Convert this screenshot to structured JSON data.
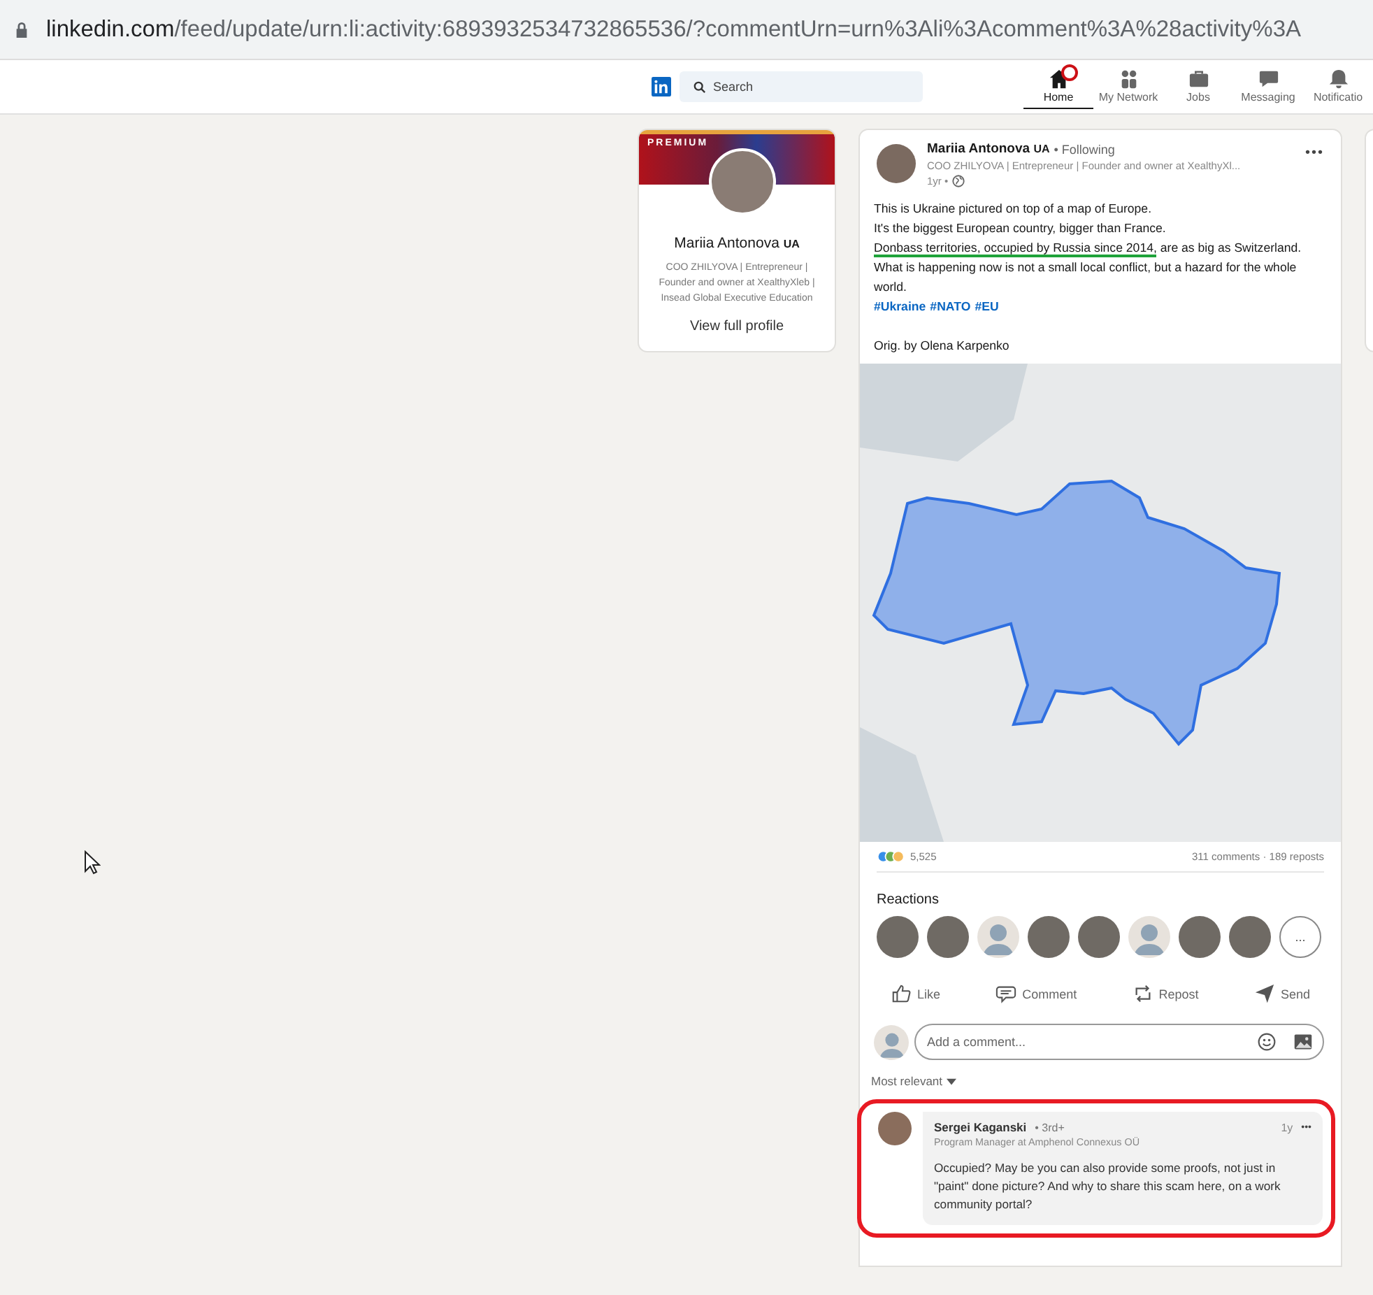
{
  "browser": {
    "url_host": "linkedin.com",
    "url_path": "/feed/update/urn:li:activity:6893932534732865536/?commentUrn=urn%3Ali%3Acomment%3A%28activity%3A"
  },
  "nav": {
    "search": {
      "placeholder": "Search"
    },
    "items": [
      {
        "label": "Home",
        "kind": "home",
        "selected": true,
        "badge": true
      },
      {
        "label": "My Network",
        "kind": "network",
        "selected": false,
        "badge": false
      },
      {
        "label": "Jobs",
        "kind": "jobs",
        "selected": false,
        "badge": false
      },
      {
        "label": "Messaging",
        "kind": "messaging",
        "selected": false,
        "badge": false
      },
      {
        "label": "Notificatio",
        "kind": "bell",
        "selected": false,
        "badge": false
      }
    ]
  },
  "profile_card": {
    "banner_label": "PREMIUM",
    "name": "Mariia Antonova",
    "name_badge": "UA",
    "headline": "COO ZHILYOVA | Entrepreneur | Founder and owner at XealthyXleb | Insead Global Executive Education",
    "link": "View full profile"
  },
  "post": {
    "author": "Mariia Antonova",
    "author_badge": "UA",
    "follow_status": "• Following",
    "headline": "COO ZHILYOVA | Entrepreneur | Founder and owner at XealthyXl...",
    "age": "1yr •",
    "more": "•••",
    "lines": [
      {
        "text": "This is Ukraine pictured on top of a map of Europe."
      },
      {
        "text": "It's the biggest European country, bigger than France."
      },
      {
        "marked": "Donbass territories, occupied by Russia since 2014,",
        "text": " are as big as Switzerland."
      },
      {
        "text": "What is happening now is not a small local conflict, but a hazard for the whole world."
      }
    ],
    "hashtags": [
      "#Ukraine",
      "#NATO",
      "#EU"
    ],
    "credit": "Orig. by Olena Karpenko",
    "reactions_count": "5,525",
    "comments_count": "311 comments",
    "stats_separator": "·",
    "reposts_count": "189 reposts",
    "reactions_title": "Reactions",
    "reactors": [
      {
        "kind": "photo"
      },
      {
        "kind": "photo"
      },
      {
        "kind": "silhouette"
      },
      {
        "kind": "photo"
      },
      {
        "kind": "photo"
      },
      {
        "kind": "silhouette"
      },
      {
        "kind": "photo"
      },
      {
        "kind": "photo"
      }
    ],
    "more_reactors": "...",
    "actions": [
      {
        "label": "Like",
        "kind": "like"
      },
      {
        "label": "Comment",
        "kind": "comment"
      },
      {
        "label": "Repost",
        "kind": "repost"
      },
      {
        "label": "Send",
        "kind": "send"
      }
    ],
    "comment_input": {
      "placeholder": "Add a comment..."
    },
    "sort": "Most relevant",
    "comments": [
      {
        "author": "Sergei Kaganski",
        "degree": "• 3rd+",
        "headline": "Program Manager at Amphenol Connexus OÜ",
        "age": "1y",
        "more": "•••",
        "text": "Occupied? May be you can also provide some proofs, not just in \"paint\" done picture? And why to share this scam here, on a work community portal?",
        "highlighted": true
      }
    ]
  }
}
